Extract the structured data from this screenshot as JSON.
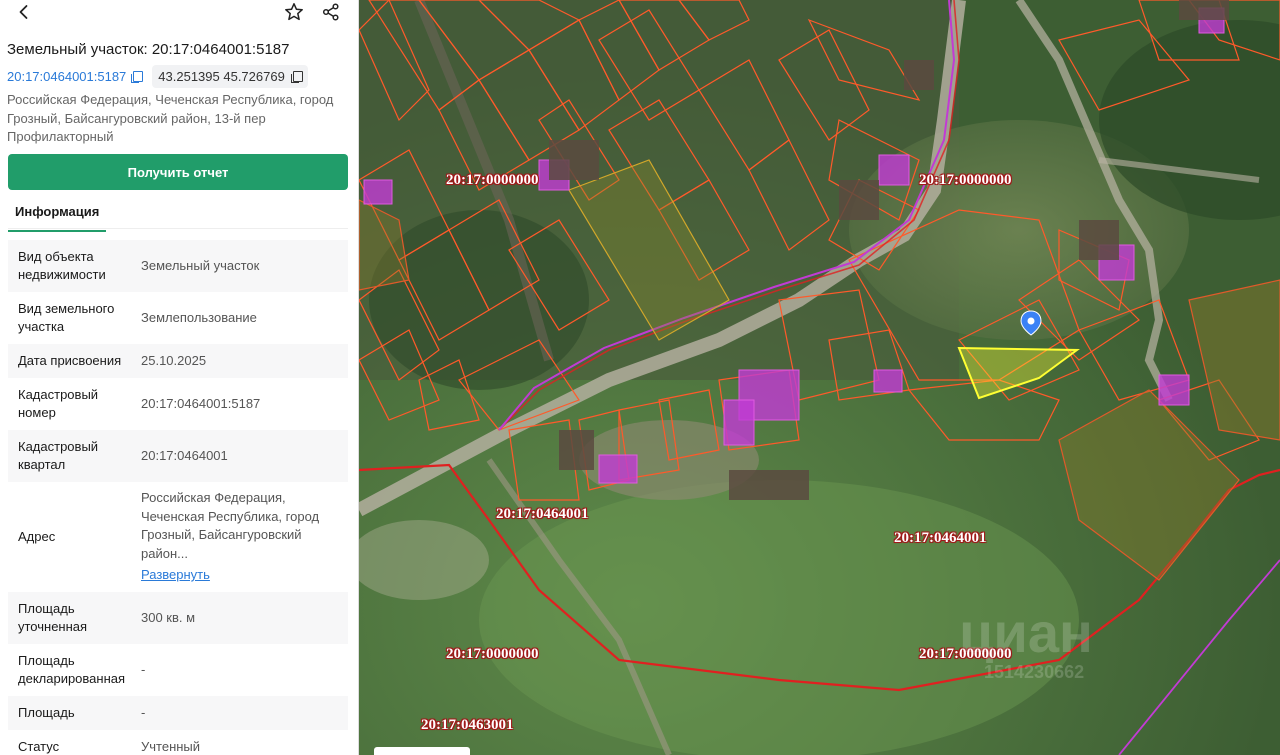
{
  "panel": {
    "title": "Земельный участок: 20:17:0464001:5187",
    "cad_link": "20:17:0464001:5187",
    "coords": "43.251395 45.726769",
    "address": "Российская Федерация, Чеченская Республика, город Грозный, Байсангуровский район, 13-й пер Профилакторный",
    "report_button": "Получить отчет",
    "tab_info": "Информация",
    "rows": [
      {
        "key": "Вид объекта недвижимости",
        "value": "Земельный участок"
      },
      {
        "key": "Вид земельного участка",
        "value": "Землепользование"
      },
      {
        "key": "Дата присвоения",
        "value": "25.10.2025"
      },
      {
        "key": "Кадастровый номер",
        "value": "20:17:0464001:5187"
      },
      {
        "key": "Кадастровый квартал",
        "value": "20:17:0464001"
      },
      {
        "key": "Адрес",
        "value": "Российская Федерация, Чеченская Республика, город Грозный, Байсангуровский район...",
        "extra": "Развернуть"
      },
      {
        "key": "Площадь уточненная",
        "value": "300 кв. м"
      },
      {
        "key": "Площадь декларированная",
        "value": "-"
      },
      {
        "key": "Площадь",
        "value": "-"
      },
      {
        "key": "Статус",
        "value": "Учтенный"
      }
    ]
  },
  "map": {
    "labels": [
      "20:17:0000000",
      "20:17:0000000",
      "20:17:0464001",
      "20:17:0464001",
      "20:17:0000000",
      "20:17:0000000",
      "20:17:0463001"
    ],
    "watermark": "циан",
    "watermark_id": "1514230662"
  },
  "colors": {
    "accent": "#219d6a",
    "link": "#2a7ad8",
    "parcel_outline": "#ff5a2a",
    "quarter_border": "#e02020",
    "building_fill": "#c23bd4",
    "selected_parcel": "#ffff33",
    "pin": "#3b82f6"
  },
  "icons": [
    "chevron-left-icon",
    "star-icon",
    "share-icon",
    "copy-icon",
    "map-pin-icon"
  ]
}
